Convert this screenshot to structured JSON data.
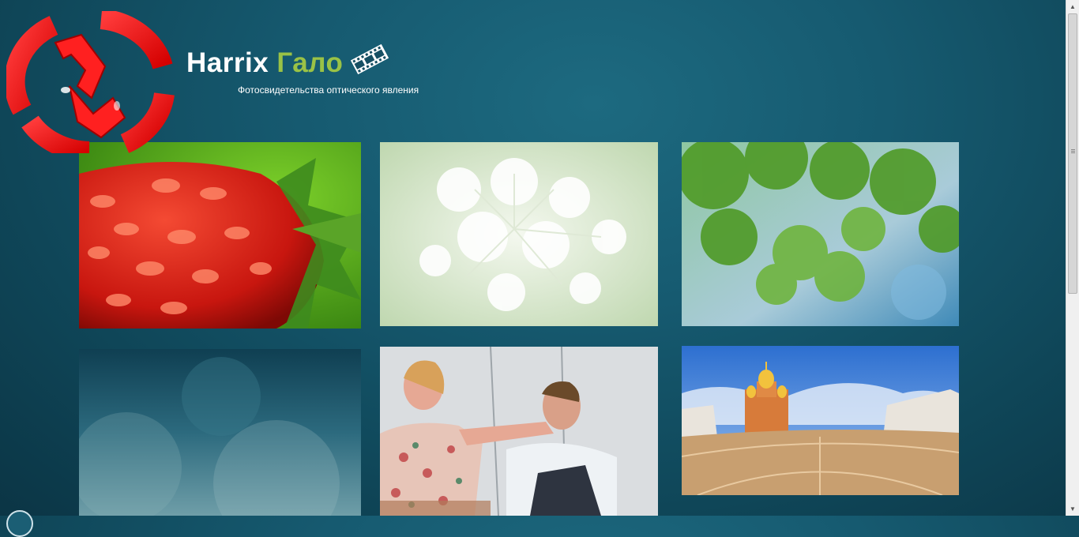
{
  "header": {
    "title_main": "Harrix",
    "title_accent": "Гало",
    "tagline": "Фотосвидетельства оптического явления"
  },
  "icons": {
    "logo": "harrix-logo",
    "film": "film-strip-icon"
  },
  "colors": {
    "background": "#165a70",
    "title": "#ffffff",
    "title_accent": "#9ac246",
    "logo": "#ff1a1a"
  },
  "gallery": [
    {
      "name": "strawberry"
    },
    {
      "name": "white-flowers"
    },
    {
      "name": "green-leaves"
    },
    {
      "name": "blue-sky-blur"
    },
    {
      "name": "couple-portrait"
    },
    {
      "name": "church-panorama"
    }
  ]
}
